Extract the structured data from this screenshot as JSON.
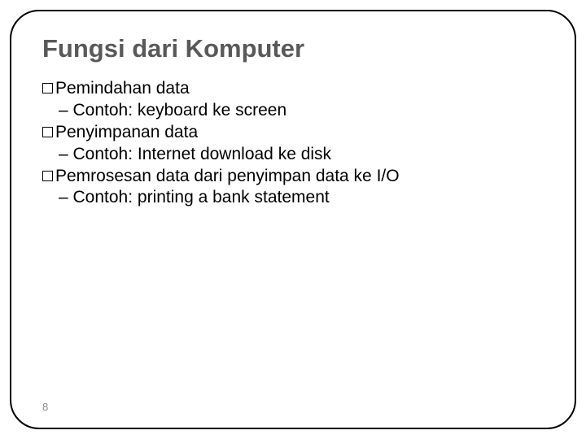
{
  "title": "Fungsi dari Komputer",
  "items": [
    {
      "text": "Pemindahan data",
      "sub": "– Contoh: keyboard ke screen"
    },
    {
      "text": "Penyimpanan data",
      "sub": "– Contoh: Internet download ke disk"
    },
    {
      "text": "Pemrosesan data dari penyimpan data ke I/O",
      "sub": "– Contoh: printing a bank statement"
    }
  ],
  "page_number": "8"
}
